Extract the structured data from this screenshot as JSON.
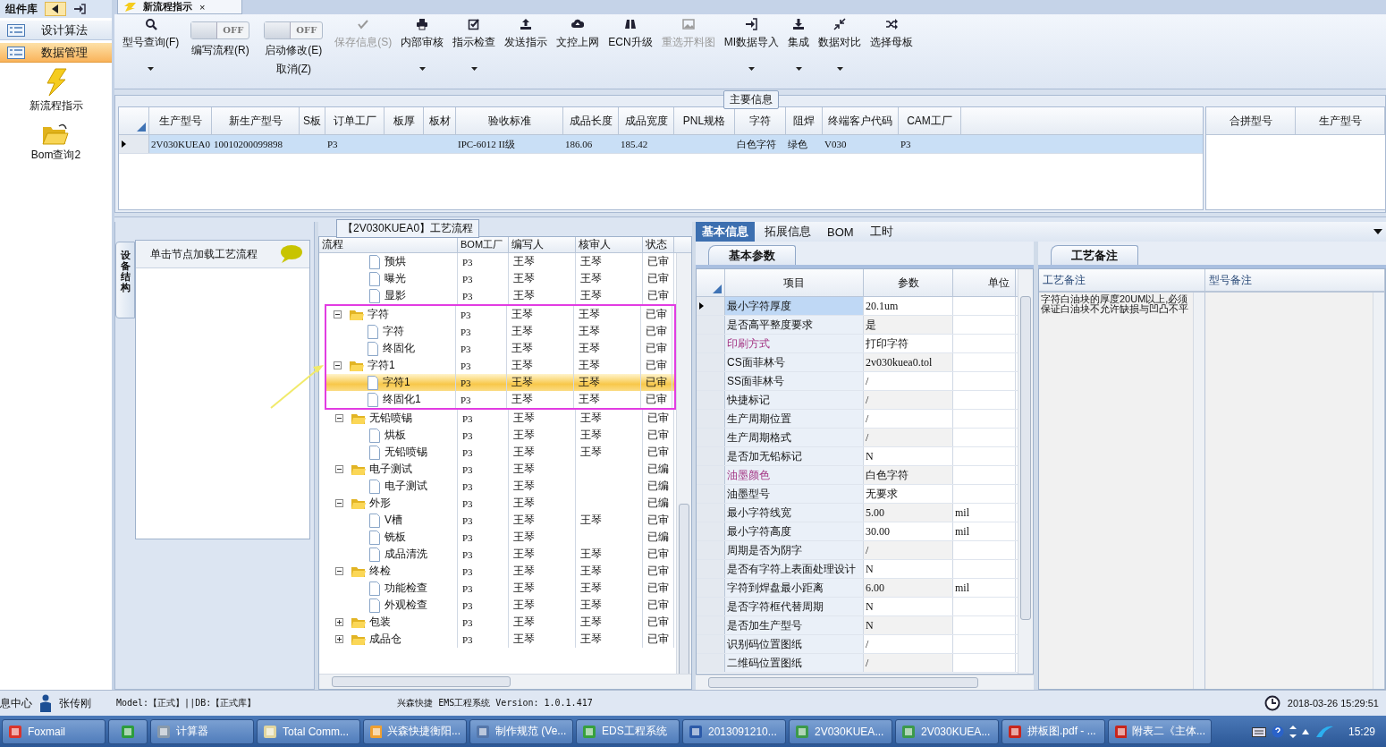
{
  "sidebar": {
    "title": "组件库",
    "groups": [
      {
        "label": "设计算法",
        "selected": false
      },
      {
        "label": "数据管理",
        "selected": true
      }
    ],
    "items": [
      {
        "label": "新流程指示"
      },
      {
        "label": "Bom查询2"
      }
    ]
  },
  "document_tab": {
    "label": "新流程指示",
    "close": "×"
  },
  "ribbon": [
    {
      "kind": "button",
      "label": "型号查询(F)",
      "disabled": false,
      "dropdown": true
    },
    {
      "kind": "toggle",
      "labels": [
        "编写流程(R)"
      ],
      "switch_text": "OFF",
      "on": false
    },
    {
      "kind": "toggle",
      "labels": [
        "启动修改(E)",
        "取消(Z)"
      ],
      "switch_text": "OFF",
      "on": false
    },
    {
      "kind": "button",
      "label": "保存信息(S)",
      "disabled": true,
      "dropdown": false
    },
    {
      "kind": "button",
      "label": "内部审核",
      "disabled": false,
      "dropdown": true
    },
    {
      "kind": "button",
      "label": "指示检查",
      "disabled": false,
      "dropdown": true
    },
    {
      "kind": "button",
      "label": "发送指示",
      "disabled": false,
      "dropdown": false
    },
    {
      "kind": "button",
      "label": "文控上网",
      "disabled": false,
      "dropdown": false
    },
    {
      "kind": "button",
      "label": "ECN升级",
      "disabled": false,
      "dropdown": false
    },
    {
      "kind": "button",
      "label": "重选开料图",
      "disabled": true,
      "dropdown": false
    },
    {
      "kind": "button",
      "label": "MI数据导入",
      "disabled": false,
      "dropdown": true
    },
    {
      "kind": "button",
      "label": "集成",
      "disabled": false,
      "dropdown": true
    },
    {
      "kind": "button",
      "label": "数据对比",
      "disabled": false,
      "dropdown": true
    },
    {
      "kind": "button",
      "label": "选择母板",
      "disabled": false,
      "dropdown": false
    }
  ],
  "main_info": {
    "title": "主要信息",
    "columns": [
      "生产型号",
      "新生产型号",
      "S板",
      "订单工厂",
      "板厚",
      "板材",
      "验收标准",
      "成品长度",
      "成品宽度",
      "PNL规格",
      "字符",
      "阻焊",
      "终端客户代码",
      "CAM工厂"
    ],
    "rows": [
      {
        "selected": true,
        "cells": [
          "2V030KUEA0",
          "10010200099898",
          null,
          "P3",
          null,
          null,
          "IPC-6012 II级",
          "186.06",
          "185.42",
          null,
          "白色字符",
          "绿色",
          "V030",
          "P3"
        ]
      }
    ],
    "side_columns": [
      "合拼型号",
      "生产型号"
    ]
  },
  "device_panel": {
    "tab": "设备结构",
    "hint": "单击节点加载工艺流程"
  },
  "process_flow": {
    "title": "【2V030KUEA0】工艺流程",
    "columns": [
      "流程",
      "BOM工厂",
      "编写人",
      "核审人",
      "状态"
    ],
    "tree": [
      {
        "children": [
          {
            "label": "预烘",
            "factory": "P3",
            "writer": "王琴",
            "reviewer": "王琴",
            "status": "已审",
            "selected": false
          },
          {
            "label": "曝光",
            "factory": "P3",
            "writer": "王琴",
            "reviewer": "王琴",
            "status": "已审",
            "selected": false
          },
          {
            "label": "显影",
            "factory": "P3",
            "writer": "王琴",
            "reviewer": "王琴",
            "status": "已审",
            "selected": false
          }
        ]
      },
      {
        "label": "字符",
        "factory": "P3",
        "writer": "王琴",
        "reviewer": "王琴",
        "status": "已审",
        "selected": false,
        "expanded": true,
        "children": [
          {
            "label": "字符",
            "factory": "P3",
            "writer": "王琴",
            "reviewer": "王琴",
            "status": "已审",
            "selected": false
          },
          {
            "label": "终固化",
            "factory": "P3",
            "writer": "王琴",
            "reviewer": "王琴",
            "status": "已审",
            "selected": false
          }
        ]
      },
      {
        "label": "字符1",
        "factory": "P3",
        "writer": "王琴",
        "reviewer": "王琴",
        "status": "已审",
        "selected": false,
        "expanded": true,
        "children": [
          {
            "label": "字符1",
            "factory": "P3",
            "writer": "王琴",
            "reviewer": "王琴",
            "status": "已审",
            "selected": true
          },
          {
            "label": "终固化1",
            "factory": "P3",
            "writer": "王琴",
            "reviewer": "王琴",
            "status": "已审",
            "selected": false
          }
        ]
      },
      {
        "label": "无铅喷锡",
        "factory": "P3",
        "writer": "王琴",
        "reviewer": "王琴",
        "status": "已审",
        "selected": false,
        "expanded": true,
        "children": [
          {
            "label": "烘板",
            "factory": "P3",
            "writer": "王琴",
            "reviewer": "王琴",
            "status": "已审",
            "selected": false
          },
          {
            "label": "无铅喷锡",
            "factory": "P3",
            "writer": "王琴",
            "reviewer": "王琴",
            "status": "已审",
            "selected": false
          }
        ]
      },
      {
        "label": "电子测试",
        "factory": "P3",
        "writer": "王琴",
        "status": "已编",
        "selected": false,
        "expanded": true,
        "children": [
          {
            "label": "电子测试",
            "factory": "P3",
            "writer": "王琴",
            "status": "已编",
            "selected": false
          }
        ]
      },
      {
        "label": "外形",
        "factory": "P3",
        "writer": "王琴",
        "status": "已编",
        "selected": false,
        "expanded": true,
        "children": [
          {
            "label": "V槽",
            "factory": "P3",
            "writer": "王琴",
            "reviewer": "王琴",
            "status": "已审",
            "selected": false
          },
          {
            "label": "铣板",
            "factory": "P3",
            "writer": "王琴",
            "status": "已编",
            "selected": false
          },
          {
            "label": "成品清洗",
            "factory": "P3",
            "writer": "王琴",
            "reviewer": "王琴",
            "status": "已审",
            "selected": false
          }
        ]
      },
      {
        "label": "终检",
        "factory": "P3",
        "writer": "王琴",
        "reviewer": "王琴",
        "status": "已审",
        "selected": false,
        "expanded": true,
        "children": [
          {
            "label": "功能检查",
            "factory": "P3",
            "writer": "王琴",
            "reviewer": "王琴",
            "status": "已审",
            "selected": false
          },
          {
            "label": "外观检查",
            "factory": "P3",
            "writer": "王琴",
            "reviewer": "王琴",
            "status": "已审",
            "selected": false
          }
        ]
      },
      {
        "label": "包装",
        "factory": "P3",
        "writer": "王琴",
        "reviewer": "王琴",
        "status": "已审",
        "selected": false,
        "expanded": false
      },
      {
        "label": "成品仓",
        "factory": "P3",
        "writer": "王琴",
        "reviewer": "王琴",
        "status": "已审",
        "selected": false,
        "expanded": false
      }
    ]
  },
  "detail_tabs": [
    {
      "label": "基本信息",
      "selected": true
    },
    {
      "label": "拓展信息",
      "selected": false
    },
    {
      "label": "BOM",
      "selected": false
    },
    {
      "label": "工时",
      "selected": false
    }
  ],
  "basic_params": {
    "tab": "基本参数",
    "columns": [
      "项目",
      "参数",
      "单位"
    ],
    "rows": [
      {
        "item": "最小字符厚度",
        "value": "20.1um",
        "selected": true,
        "marked": false
      },
      {
        "item": "是否高平整度要求",
        "value": "是",
        "selected": false,
        "marked": false
      },
      {
        "item": "印刷方式",
        "value": "打印字符",
        "selected": false,
        "marked": true
      },
      {
        "item": "CS面菲林号",
        "value": "2v030kuea0.tol",
        "selected": false,
        "marked": false
      },
      {
        "item": "SS面菲林号",
        "value": "/",
        "selected": false,
        "marked": false
      },
      {
        "item": "快捷标记",
        "value": "/",
        "selected": false,
        "marked": false
      },
      {
        "item": "生产周期位置",
        "value": "/",
        "selected": false,
        "marked": false
      },
      {
        "item": "生产周期格式",
        "value": "/",
        "selected": false,
        "marked": false
      },
      {
        "item": "是否加无铅标记",
        "value": "N",
        "selected": false,
        "marked": false
      },
      {
        "item": "油墨颜色",
        "value": "白色字符",
        "selected": false,
        "marked": true
      },
      {
        "item": "油墨型号",
        "value": "无要求",
        "selected": false,
        "marked": false
      },
      {
        "item": "最小字符线宽",
        "value": "5.00",
        "unit": "mil",
        "selected": false,
        "marked": false
      },
      {
        "item": "最小字符高度",
        "value": "30.00",
        "unit": "mil",
        "selected": false,
        "marked": false
      },
      {
        "item": "周期是否为阴字",
        "value": "/",
        "selected": false,
        "marked": false
      },
      {
        "item": "是否有字符上表面处理设计",
        "value": "N",
        "selected": false,
        "marked": false
      },
      {
        "item": "字符到焊盘最小距离",
        "value": "6.00",
        "unit": "mil",
        "selected": false,
        "marked": false
      },
      {
        "item": "是否字符框代替周期",
        "value": "N",
        "selected": false,
        "marked": false
      },
      {
        "item": "是否加生产型号",
        "value": "N",
        "selected": false,
        "marked": false
      },
      {
        "item": "识别码位置图纸",
        "value": "/",
        "selected": false,
        "marked": false
      },
      {
        "item": "二维码位置图纸",
        "value": "/",
        "selected": false,
        "marked": false
      }
    ]
  },
  "notes": {
    "tab": "工艺备注",
    "columns": [
      "工艺备注",
      "型号备注"
    ],
    "text": "字符白油块的厚度20UM以上,必须保证白油块不允许缺损与凹凸不平"
  },
  "status_bar": {
    "left": "息中心",
    "user": "张传刚",
    "model": "Model:【正式】||DB:【正式库】",
    "app": "兴森快捷 EMS工程系统 Version: 1.0.1.417",
    "datetime": "2018-03-26 15:29:51"
  },
  "taskbar": {
    "items": [
      {
        "kind": "labeled",
        "label": "Foxmail"
      },
      {
        "kind": "icon"
      },
      {
        "kind": "labeled",
        "label": "计算器"
      },
      {
        "kind": "labeled",
        "label": "Total Comm..."
      },
      {
        "kind": "labeled",
        "label": "兴森快捷衡阳..."
      },
      {
        "kind": "labeled",
        "label": "制作规范 (Ve..."
      },
      {
        "kind": "labeled",
        "label": "EDS工程系统"
      },
      {
        "kind": "labeled",
        "label": "2013091210..."
      },
      {
        "kind": "labeled",
        "label": "2V030KUEA..."
      },
      {
        "kind": "labeled",
        "label": "2V030KUEA..."
      },
      {
        "kind": "labeled",
        "label": "拼板图.pdf - ..."
      },
      {
        "kind": "labeled",
        "label": "附表二《主体..."
      }
    ],
    "clock": "15:29"
  }
}
